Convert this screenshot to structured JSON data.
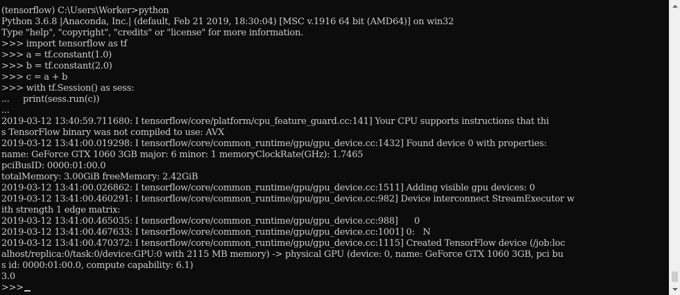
{
  "console": {
    "lines": [
      "(tensorflow) C:\\Users\\Worker>python",
      "Python 3.6.8 |Anaconda, Inc.| (default, Feb 21 2019, 18:30:04) [MSC v.1916 64 bit (AMD64)] on win32",
      "Type \"help\", \"copyright\", \"credits\" or \"license\" for more information.",
      ">>> import tensorflow as tf",
      ">>> a = tf.constant(1.0)",
      ">>> b = tf.constant(2.0)",
      ">>> c = a + b",
      ">>> with tf.Session() as sess:",
      "...     print(sess.run(c))",
      "...",
      "2019-03-12 13:40:59.711680: I tensorflow/core/platform/cpu_feature_guard.cc:141] Your CPU supports instructions that thi",
      "s TensorFlow binary was not compiled to use: AVX",
      "2019-03-12 13:41:00.019298: I tensorflow/core/common_runtime/gpu/gpu_device.cc:1432] Found device 0 with properties:",
      "name: GeForce GTX 1060 3GB major: 6 minor: 1 memoryClockRate(GHz): 1.7465",
      "pciBusID: 0000:01:00.0",
      "totalMemory: 3.00GiB freeMemory: 2.42GiB",
      "2019-03-12 13:41:00.026862: I tensorflow/core/common_runtime/gpu/gpu_device.cc:1511] Adding visible gpu devices: 0",
      "2019-03-12 13:41:00.460291: I tensorflow/core/common_runtime/gpu/gpu_device.cc:982] Device interconnect StreamExecutor w",
      "ith strength 1 edge matrix:",
      "2019-03-12 13:41:00.465035: I tensorflow/core/common_runtime/gpu/gpu_device.cc:988]      0",
      "2019-03-12 13:41:00.467633: I tensorflow/core/common_runtime/gpu/gpu_device.cc:1001] 0:   N",
      "2019-03-12 13:41:00.470372: I tensorflow/core/common_runtime/gpu/gpu_device.cc:1115] Created TensorFlow device (/job:loc",
      "alhost/replica:0/task:0/device:GPU:0 with 2115 MB memory) -> physical GPU (device: 0, name: GeForce GTX 1060 3GB, pci bu",
      "s id: 0000:01:00.0, compute capability: 6.1)",
      "3.0"
    ],
    "prompt": ">>>"
  },
  "colors": {
    "background": "#0c0c0c",
    "text": "#cccccc",
    "scrollbar_track": "#f0f0f0",
    "scrollbar_thumb": "#cdcdcd"
  },
  "icons": {
    "scroll_up": "scroll-up-arrow-icon",
    "scroll_down": "scroll-down-arrow-icon"
  }
}
